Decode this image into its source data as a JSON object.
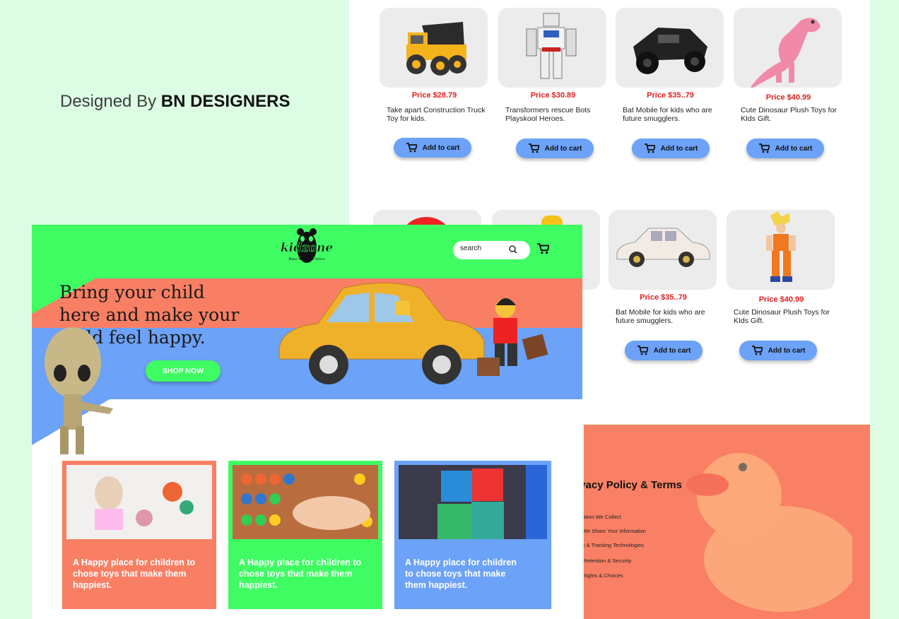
{
  "credit": {
    "prefix": "Designed By",
    "brand": "BN DESIGNERS"
  },
  "colors": {
    "green": "#3ffc63",
    "coral": "#f87f64",
    "blue": "#6ca2f7",
    "price_red": "#e02020",
    "mint_bg": "#dcfde3"
  },
  "products": [
    {
      "price": "Price  $28.79",
      "desc": "Take apart Construction Truck Toy for kids.",
      "cart": "Add to cart"
    },
    {
      "price": "Price  $30.89",
      "desc": "Transformers rescue Bots Playskool Heroes.",
      "cart": "Add to cart"
    },
    {
      "price": "Price  $35..79",
      "desc": "Bat Mobile for kids who are future smugglers.",
      "cart": "Add to cart"
    },
    {
      "price": "Price  $40.99",
      "desc": "Cute Dinosaur Plush Toys for KIds Gift.",
      "cart": "Add to cart"
    },
    {
      "price": "Price  $35..79",
      "desc": "Bat Mobile for kids who are future smugglers.",
      "cart": "Add to cart"
    },
    {
      "price": "Price  $40.99",
      "desc": "Cute Dinosaur Plush Toys for KIds Gift.",
      "cart": "Add to cart"
    }
  ],
  "privacy": {
    "title": "ivacy Policy & Terms",
    "items": [
      "mation We Collect",
      "We Share Your Information",
      "ies & Tracking Technologies",
      "Retention & Security",
      "Rights & Choices"
    ]
  },
  "site": {
    "logo": "kidzone",
    "tagline": "Make Your Child Active",
    "search_placeholder": "search",
    "hero": "Bring your child here and make your child feel happy.",
    "shop_now": "SHOP NOW"
  },
  "features": [
    {
      "text": "A Happy place for children to chose toys that make them happiest."
    },
    {
      "text": "A Happy place for children to chose toys that make them happiest."
    },
    {
      "text": "A Happy place for children to chose toys that make them happiest."
    }
  ],
  "icons": [
    "cart-icon",
    "search-icon",
    "panda-logo-icon"
  ]
}
